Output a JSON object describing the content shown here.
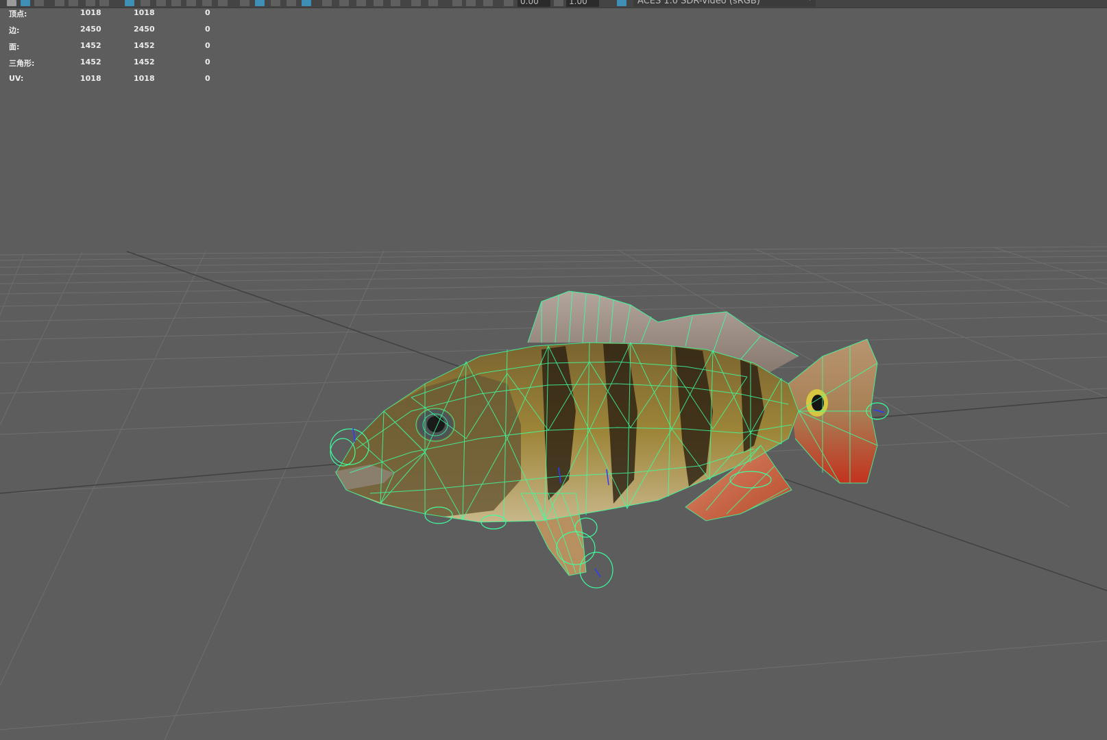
{
  "toolbar": {
    "field_a": "0.00",
    "field_b": "1.00",
    "color_space": "ACES 1.0 SDR-video (sRGB)"
  },
  "hud": {
    "rows": [
      {
        "label": "顶点:",
        "v1": "1018",
        "v2": "1018",
        "v3": "0"
      },
      {
        "label": "边:",
        "v1": "2450",
        "v2": "2450",
        "v3": "0"
      },
      {
        "label": "面:",
        "v1": "1452",
        "v2": "1452",
        "v3": "0"
      },
      {
        "label": "三角形:",
        "v1": "1452",
        "v2": "1452",
        "v3": "0"
      },
      {
        "label": "UV:",
        "v1": "1018",
        "v2": "1018",
        "v3": "0"
      }
    ]
  },
  "colors": {
    "viewport_bg": "#5d5d5d",
    "grid_line": "#6e6e6e",
    "grid_axis": "#3f3f3f",
    "wireframe": "#3dffa0"
  }
}
